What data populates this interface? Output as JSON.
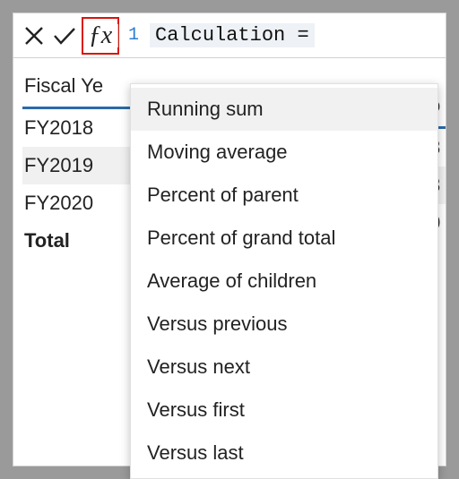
{
  "formula_bar": {
    "line_number": "1",
    "expression": "Calculation ="
  },
  "table": {
    "header": "Fiscal Ye",
    "rows": [
      {
        "label": "FY2018",
        "alt": false
      },
      {
        "label": "FY2019",
        "alt": true
      },
      {
        "label": "FY2020",
        "alt": false
      }
    ],
    "total_label": "Total"
  },
  "right_fragments": {
    "header": "o",
    "rows": [
      "8",
      "3",
      "0"
    ],
    "total": "!"
  },
  "dropdown": {
    "items": [
      "Running sum",
      "Moving average",
      "Percent of parent",
      "Percent of grand total",
      "Average of children",
      "Versus previous",
      "Versus next",
      "Versus first",
      "Versus last"
    ],
    "hover_index": 0
  }
}
